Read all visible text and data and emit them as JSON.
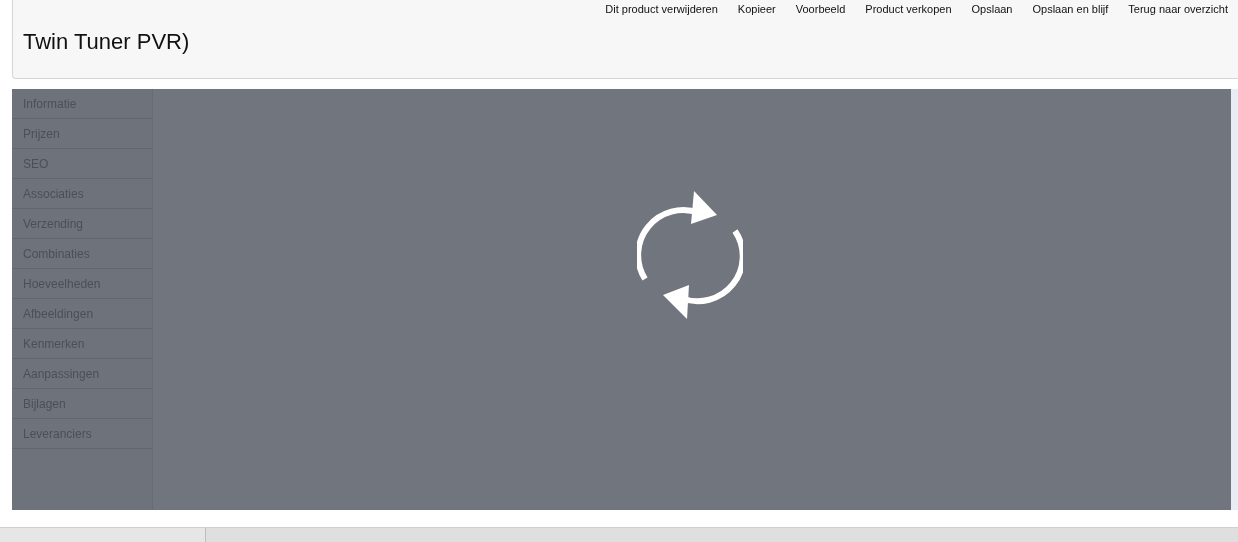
{
  "header": {
    "title": "Twin Tuner PVR)"
  },
  "toolbar": [
    {
      "label": "Dit product verwijderen"
    },
    {
      "label": "Kopieer"
    },
    {
      "label": "Voorbeeld"
    },
    {
      "label": "Product verkopen"
    },
    {
      "label": "Opslaan"
    },
    {
      "label": "Opslaan en blijf"
    },
    {
      "label": "Terug naar overzicht"
    }
  ],
  "sidebar": {
    "items": [
      {
        "label": "Informatie"
      },
      {
        "label": "Prijzen"
      },
      {
        "label": "SEO"
      },
      {
        "label": "Associaties"
      },
      {
        "label": "Verzending"
      },
      {
        "label": "Combinaties"
      },
      {
        "label": "Hoeveelheden"
      },
      {
        "label": "Afbeeldingen"
      },
      {
        "label": "Kenmerken"
      },
      {
        "label": "Aanpassingen"
      },
      {
        "label": "Bijlagen"
      },
      {
        "label": "Leveranciers"
      }
    ]
  },
  "loading": {
    "kind": "spinner"
  }
}
